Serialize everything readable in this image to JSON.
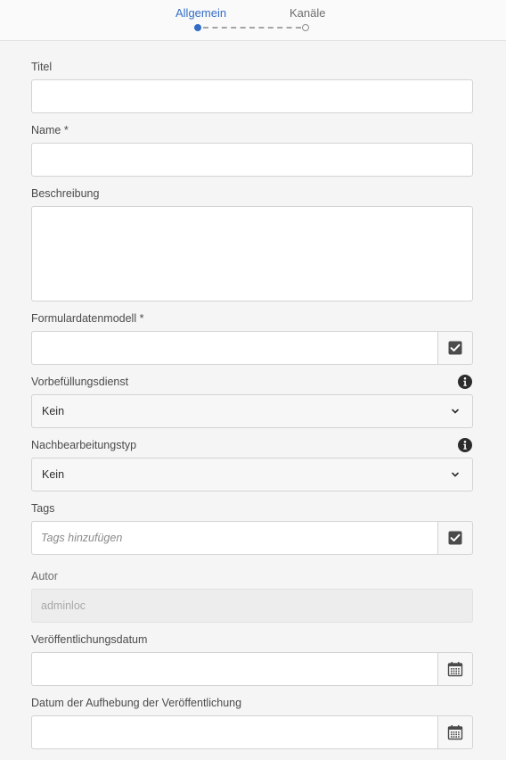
{
  "wizard": {
    "steps": [
      {
        "label": "Allgemein",
        "active": true
      },
      {
        "label": "Kanäle",
        "active": false
      }
    ],
    "accent_color": "#326ec8"
  },
  "form": {
    "title": {
      "label": "Titel",
      "value": ""
    },
    "name": {
      "label": "Name *",
      "value": ""
    },
    "description": {
      "label": "Beschreibung",
      "value": ""
    },
    "form_data_model": {
      "label": "Formulardatenmodell *",
      "value": "",
      "button_icon": "checkbox-icon"
    },
    "prefill_service": {
      "label": "Vorbefüllungsdienst",
      "selected": "Kein",
      "info_icon": "info-icon"
    },
    "post_processing": {
      "label": "Nachbearbeitungstyp",
      "selected": "Kein",
      "info_icon": "info-icon"
    },
    "tags": {
      "label": "Tags",
      "placeholder": "Tags hinzufügen",
      "button_icon": "checkbox-icon"
    },
    "author": {
      "label": "Autor",
      "value": "adminloc"
    },
    "publish_date": {
      "label": "Veröffentlichungsdatum",
      "value": "",
      "button_icon": "calendar-icon"
    },
    "unpublish_date": {
      "label": "Datum der Aufhebung der Veröffentlichung",
      "value": "",
      "button_icon": "calendar-icon"
    }
  }
}
